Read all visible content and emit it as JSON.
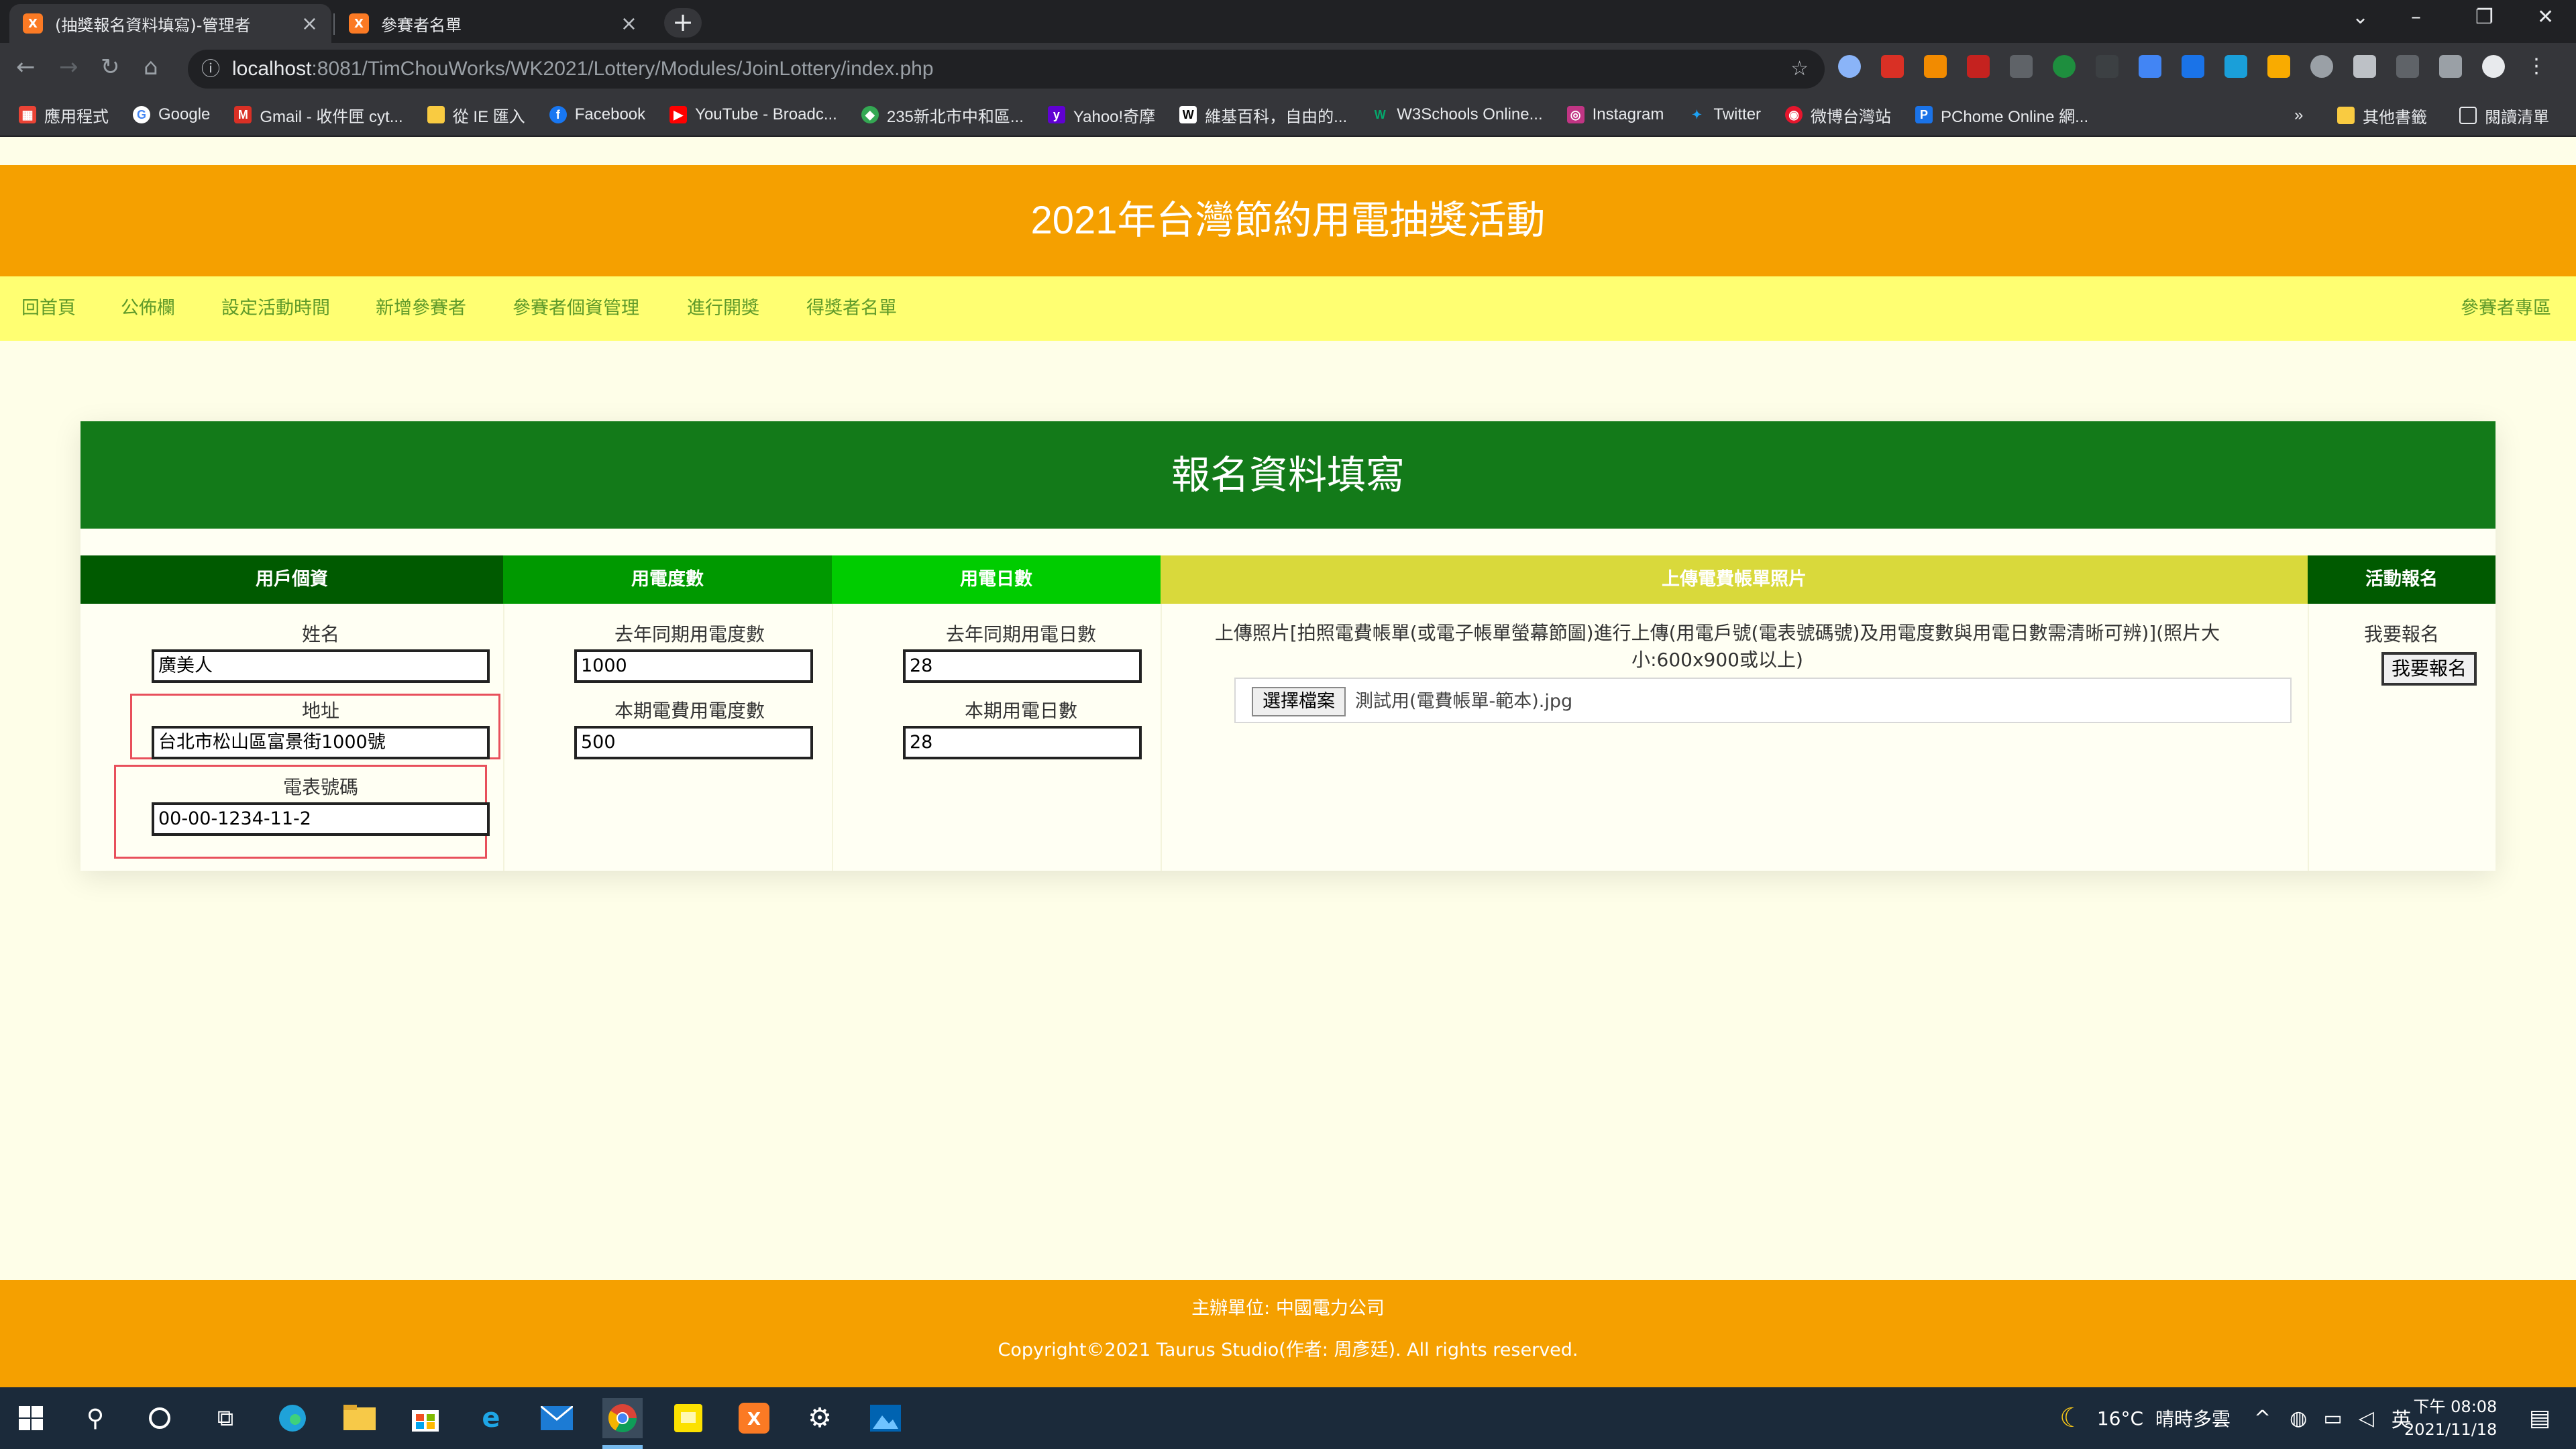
{
  "browser": {
    "tabs": [
      {
        "title": "(抽獎報名資料填寫)-管理者",
        "favicon": "xampp-icon"
      },
      {
        "title": "參賽者名單",
        "favicon": "xampp-icon"
      }
    ],
    "url_host": "localhost",
    "url_path": ":8081/TimChouWorks/WK2021/Lottery/Modules/JoinLottery/index.php",
    "bookmarks": [
      "應用程式",
      "Google",
      "Gmail - 收件匣 cyt...",
      "從 IE 匯入",
      "Facebook",
      "YouTube - Broadc...",
      "235新北市中和區...",
      "Yahoo!奇摩",
      "維基百科，自由的...",
      "W3Schools Online...",
      "Instagram",
      "Twitter",
      "微博台灣站",
      "PChome Online 網..."
    ],
    "bookmarks_overflow": "»",
    "other_bookmarks": "其他書籤",
    "reading_list": "閱讀清單"
  },
  "site": {
    "title": "2021年台灣節約用電抽獎活動",
    "nav": [
      "回首頁",
      "公佈欄",
      "設定活動時間",
      "新增參賽者",
      "參賽者個資管理",
      "進行開獎",
      "得獎者名單"
    ],
    "nav_right": "參賽者專區",
    "footer_line1": "主辦單位: 中國電力公司",
    "footer_line2": "Copyright©2021 Taurus Studio(作者: 周彥廷). All rights reserved."
  },
  "form": {
    "title": "報名資料填寫",
    "columns": [
      "用戶個資",
      "用電度數",
      "用電日數",
      "上傳電費帳單照片",
      "活動報名"
    ],
    "name_label": "姓名",
    "name_value": "廣美人",
    "address_label": "地址",
    "address_value": "台北市松山區富景街1000號",
    "meter_label": "電表號碼",
    "meter_value": "00-00-1234-11-2",
    "last_year_kwh_label": "去年同期用電度數",
    "last_year_kwh_value": "1000",
    "this_kwh_label": "本期電費用電度數",
    "this_kwh_value": "500",
    "last_year_days_label": "去年同期用電日數",
    "last_year_days_value": "28",
    "this_days_label": "本期用電日數",
    "this_days_value": "28",
    "upload_desc": "上傳照片[拍照電費帳單(或電子帳單螢幕節圖)進行上傳(用電戶號(電表號碼號)及用電度數與用電日數需清晰可辨)](照片大小:600x900或以上)",
    "file_button": "選擇檔案",
    "file_name": "測試用(電費帳單-範本).jpg",
    "signup_label": "我要報名",
    "signup_button": "我要報名"
  },
  "taskbar": {
    "temperature": "16°C",
    "weather": "晴時多雲",
    "ime": "英",
    "time": "下午 08:08",
    "date": "2021/11/18"
  },
  "colors": {
    "header_orange": "#f5a000",
    "nav_yellow": "#ffff72",
    "card_green": "#137a19",
    "col1": "#005a00",
    "col2": "#009900",
    "col3": "#00cc00",
    "col4": "#d9d93b",
    "col5": "#005a00",
    "highlight_red": "#e8505b"
  }
}
